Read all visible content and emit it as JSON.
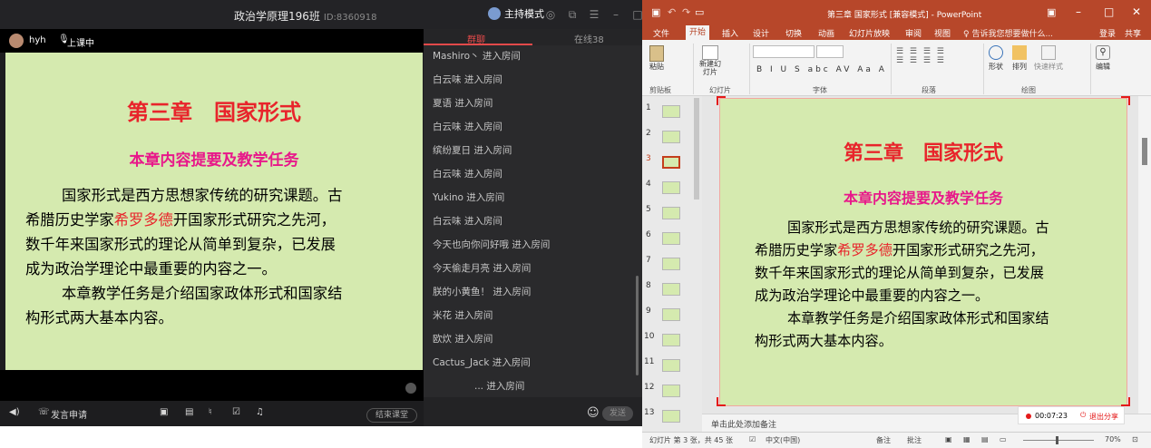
{
  "left": {
    "title": "政治学原理196班",
    "room_id": "ID:8360918",
    "host_mode": "主持模式",
    "user": "hyh",
    "class_status": "上课中",
    "tabs": [
      "群聊",
      "在线38"
    ],
    "messages": [
      "Mashiro丶 进入房间",
      "白云味 进入房间",
      "夏语 进入房间",
      "白云味 进入房间",
      "缤纷夏日 进入房间",
      "白云味 进入房间",
      "Yukino 进入房间",
      "白云味 进入房间",
      "今天也向你问好哦 进入房间",
      "今天偷走月亮 进入房间",
      "朕的小黄鱼！ 进入房间",
      "米花 进入房间",
      "欧炊 进入房间",
      "Cactus_Jack 进入房间",
      "... 进入房间"
    ],
    "send": "发送",
    "speak_request": "发言申请",
    "end_class": "结束课堂"
  },
  "slide": {
    "title": "第三章　国家形式",
    "subtitle": "本章内容提要及教学任务",
    "p1_l1": "国家形式是西方思想家传统的研究课题。古",
    "p1_l2a": "希腊历史学家",
    "p1_l2red": "希罗多德",
    "p1_l2b": "开国家形式研究之先河，",
    "p1_l3": "数千年来国家形式的理论从简单到复杂，已发展",
    "p1_l4": "成为政治学理论中最重要的内容之一。",
    "p2_l1": "本章教学任务是介绍国家政体形式和国家结",
    "p2_l2": "构形式两大基本内容。"
  },
  "ppt": {
    "title": "第三章 国家形式 [兼容模式] - PowerPoint",
    "menu": [
      "文件",
      "开始",
      "插入",
      "设计",
      "切换",
      "动画",
      "幻灯片放映",
      "审阅",
      "视图"
    ],
    "tell_me": "♀ 告诉我您想要做什么...",
    "login": "登录",
    "share": "共享",
    "groups": [
      "剪贴板",
      "幻灯片",
      "字体",
      "段落",
      "绘图"
    ],
    "paste": "粘贴",
    "new_slide": "新建幻灯片",
    "shape": "形状",
    "arrange": "排列",
    "quick_style": "快速样式",
    "edit": "编辑",
    "thumb_nums": [
      "1",
      "2",
      "3",
      "4",
      "5",
      "6",
      "7",
      "8",
      "9",
      "10",
      "11",
      "12",
      "13"
    ],
    "notes_placeholder": "单击此处添加备注",
    "rec_time": "00:07:23",
    "exit_share": "退出分享",
    "status_slide": "幻灯片 第 3 张，共 45 张",
    "status_lang": "中文(中国)",
    "status_notes": "备注",
    "status_comments": "批注",
    "zoom": "70%"
  }
}
